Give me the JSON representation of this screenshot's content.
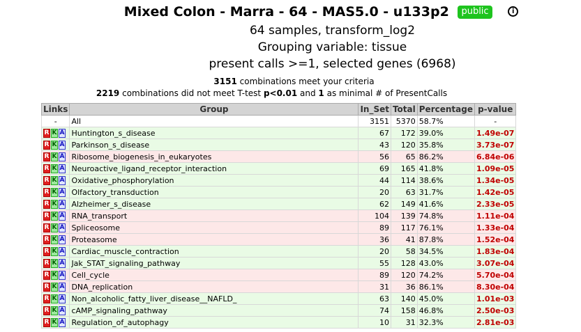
{
  "header": {
    "title": "Mixed Colon - Marra - 64 - MAS5.0 - u133p2",
    "badge": "public",
    "info_icon": "info-icon",
    "line1": "64 samples, transform_log2",
    "line2": "Grouping variable: tissue",
    "line3": "present calls >=1, selected genes (6968)"
  },
  "criteria": {
    "met_count": "3151",
    "met_text": " combinations meet your criteria",
    "notmet_count": "2219",
    "notmet_text1": " combinations did not meet T-test ",
    "notmet_p": "p<0.01",
    "notmet_text2": " and ",
    "notmet_min": "1",
    "notmet_text3": " as minimal # of PresentCalls"
  },
  "table": {
    "headers": [
      "Links",
      "Group",
      "In_Set",
      "Total",
      "Percentage",
      "p-value"
    ],
    "link_labels": [
      "R",
      "K",
      "A"
    ],
    "all_row": {
      "links": "-",
      "group": "All",
      "in_set": "3151",
      "total": "5370",
      "pct": "58.7%",
      "pval": "-"
    },
    "rows": [
      {
        "group": "Huntington_s_disease",
        "in_set": "67",
        "total": "172",
        "pct": "39.0%",
        "pval": "1.49e-07",
        "tone": "green"
      },
      {
        "group": "Parkinson_s_disease",
        "in_set": "43",
        "total": "120",
        "pct": "35.8%",
        "pval": "3.73e-07",
        "tone": "green"
      },
      {
        "group": "Ribosome_biogenesis_in_eukaryotes",
        "in_set": "56",
        "total": "65",
        "pct": "86.2%",
        "pval": "6.84e-06",
        "tone": "pink"
      },
      {
        "group": "Neuroactive_ligand_receptor_interaction",
        "in_set": "69",
        "total": "165",
        "pct": "41.8%",
        "pval": "1.09e-05",
        "tone": "green"
      },
      {
        "group": "Oxidative_phosphorylation",
        "in_set": "44",
        "total": "114",
        "pct": "38.6%",
        "pval": "1.34e-05",
        "tone": "green"
      },
      {
        "group": "Olfactory_transduction",
        "in_set": "20",
        "total": "63",
        "pct": "31.7%",
        "pval": "1.42e-05",
        "tone": "green"
      },
      {
        "group": "Alzheimer_s_disease",
        "in_set": "62",
        "total": "149",
        "pct": "41.6%",
        "pval": "2.33e-05",
        "tone": "green"
      },
      {
        "group": "RNA_transport",
        "in_set": "104",
        "total": "139",
        "pct": "74.8%",
        "pval": "1.11e-04",
        "tone": "pink"
      },
      {
        "group": "Spliceosome",
        "in_set": "89",
        "total": "117",
        "pct": "76.1%",
        "pval": "1.33e-04",
        "tone": "pink"
      },
      {
        "group": "Proteasome",
        "in_set": "36",
        "total": "41",
        "pct": "87.8%",
        "pval": "1.52e-04",
        "tone": "pink"
      },
      {
        "group": "Cardiac_muscle_contraction",
        "in_set": "20",
        "total": "58",
        "pct": "34.5%",
        "pval": "1.83e-04",
        "tone": "green"
      },
      {
        "group": "Jak_STAT_signaling_pathway",
        "in_set": "55",
        "total": "128",
        "pct": "43.0%",
        "pval": "3.07e-04",
        "tone": "green"
      },
      {
        "group": "Cell_cycle",
        "in_set": "89",
        "total": "120",
        "pct": "74.2%",
        "pval": "5.70e-04",
        "tone": "pink"
      },
      {
        "group": "DNA_replication",
        "in_set": "31",
        "total": "36",
        "pct": "86.1%",
        "pval": "8.30e-04",
        "tone": "pink"
      },
      {
        "group": "Non_alcoholic_fatty_liver_disease__NAFLD_",
        "in_set": "63",
        "total": "140",
        "pct": "45.0%",
        "pval": "1.01e-03",
        "tone": "green"
      },
      {
        "group": "cAMP_signaling_pathway",
        "in_set": "74",
        "total": "158",
        "pct": "46.8%",
        "pval": "2.50e-03",
        "tone": "green"
      },
      {
        "group": "Regulation_of_autophagy",
        "in_set": "10",
        "total": "31",
        "pct": "32.3%",
        "pval": "2.81e-03",
        "tone": "green"
      }
    ]
  },
  "colors": {
    "badge_bg": "#1ec41e",
    "pvalue_text": "#c00000",
    "row_green": "#e9fbe5",
    "row_pink": "#fde8e8",
    "header_bg": "#d4d4d4"
  }
}
